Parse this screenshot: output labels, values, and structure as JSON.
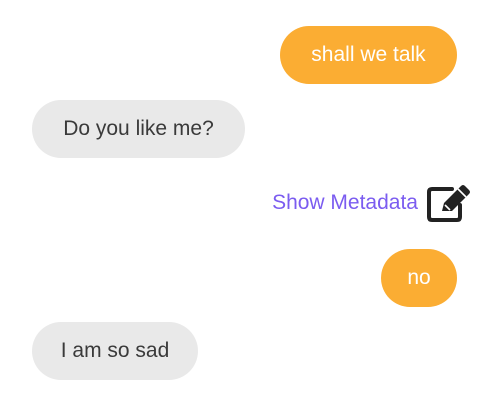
{
  "messages": [
    {
      "sender": "user",
      "text": "shall we talk"
    },
    {
      "sender": "bot",
      "text": "Do you like me?"
    },
    {
      "sender": "user",
      "text": "no"
    },
    {
      "sender": "bot",
      "text": "I am so sad"
    }
  ],
  "metadata_link": {
    "label": "Show Metadata",
    "icon": "edit-icon"
  },
  "colors": {
    "user_bubble": "#fbad33",
    "bot_bubble": "#e9e9e9",
    "link": "#7b5cf0"
  }
}
